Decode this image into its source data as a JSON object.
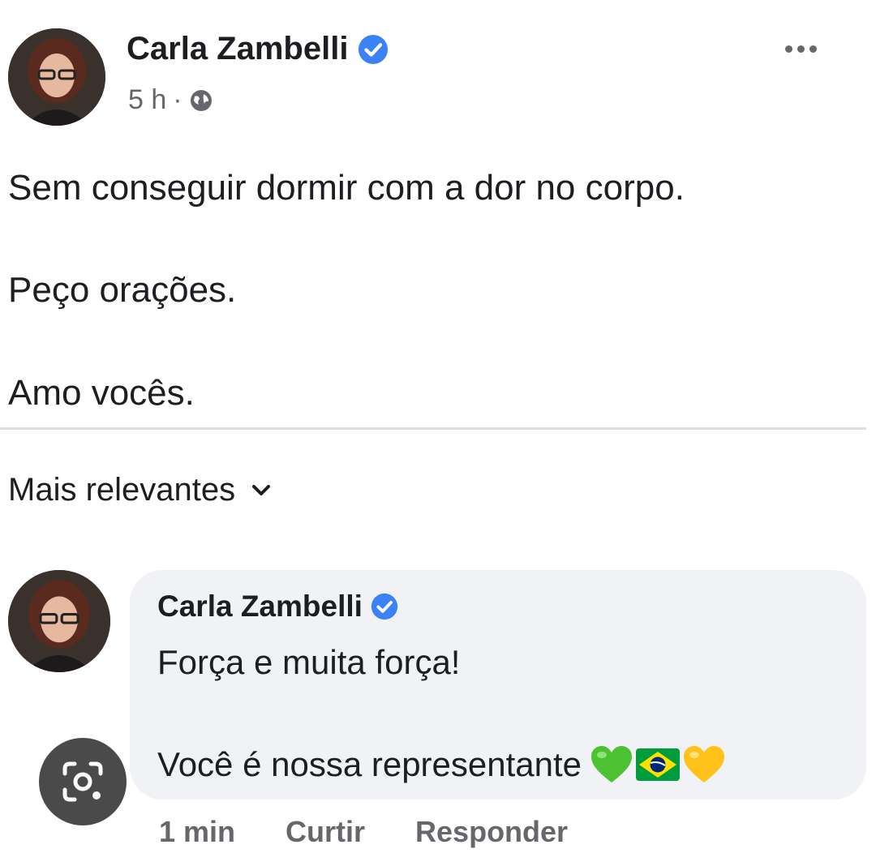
{
  "post": {
    "author_name": "Carla Zambelli",
    "verified": true,
    "time": "5 h",
    "separator": "·",
    "privacy_icon": "globe-icon",
    "more_icon": "ellipsis-icon",
    "lines": [
      "Sem conseguir dormir com a dor no corpo.",
      "Peço orações.",
      "Amo vocês."
    ]
  },
  "comments_sort": {
    "label": "Mais relevantes",
    "icon": "chevron-down-icon"
  },
  "comment": {
    "author_name": "Carla Zambelli",
    "verified": true,
    "lines": [
      "Força e muita força!",
      "Você é nossa representante"
    ],
    "emojis": [
      "green-heart-emoji",
      "brazil-flag-emoji",
      "yellow-heart-emoji"
    ],
    "time": "1 min",
    "like_label": "Curtir",
    "reply_label": "Responder"
  },
  "overlay": {
    "icon": "lens-camera-icon"
  },
  "colors": {
    "verified_blue": "#3b82f6",
    "secondary_text": "#65676b",
    "bubble_bg": "#f0f2f5",
    "divider": "#dadde1",
    "brazil_green": "#009c3b",
    "brazil_yellow": "#ffdf00",
    "brazil_blue": "#002776"
  }
}
